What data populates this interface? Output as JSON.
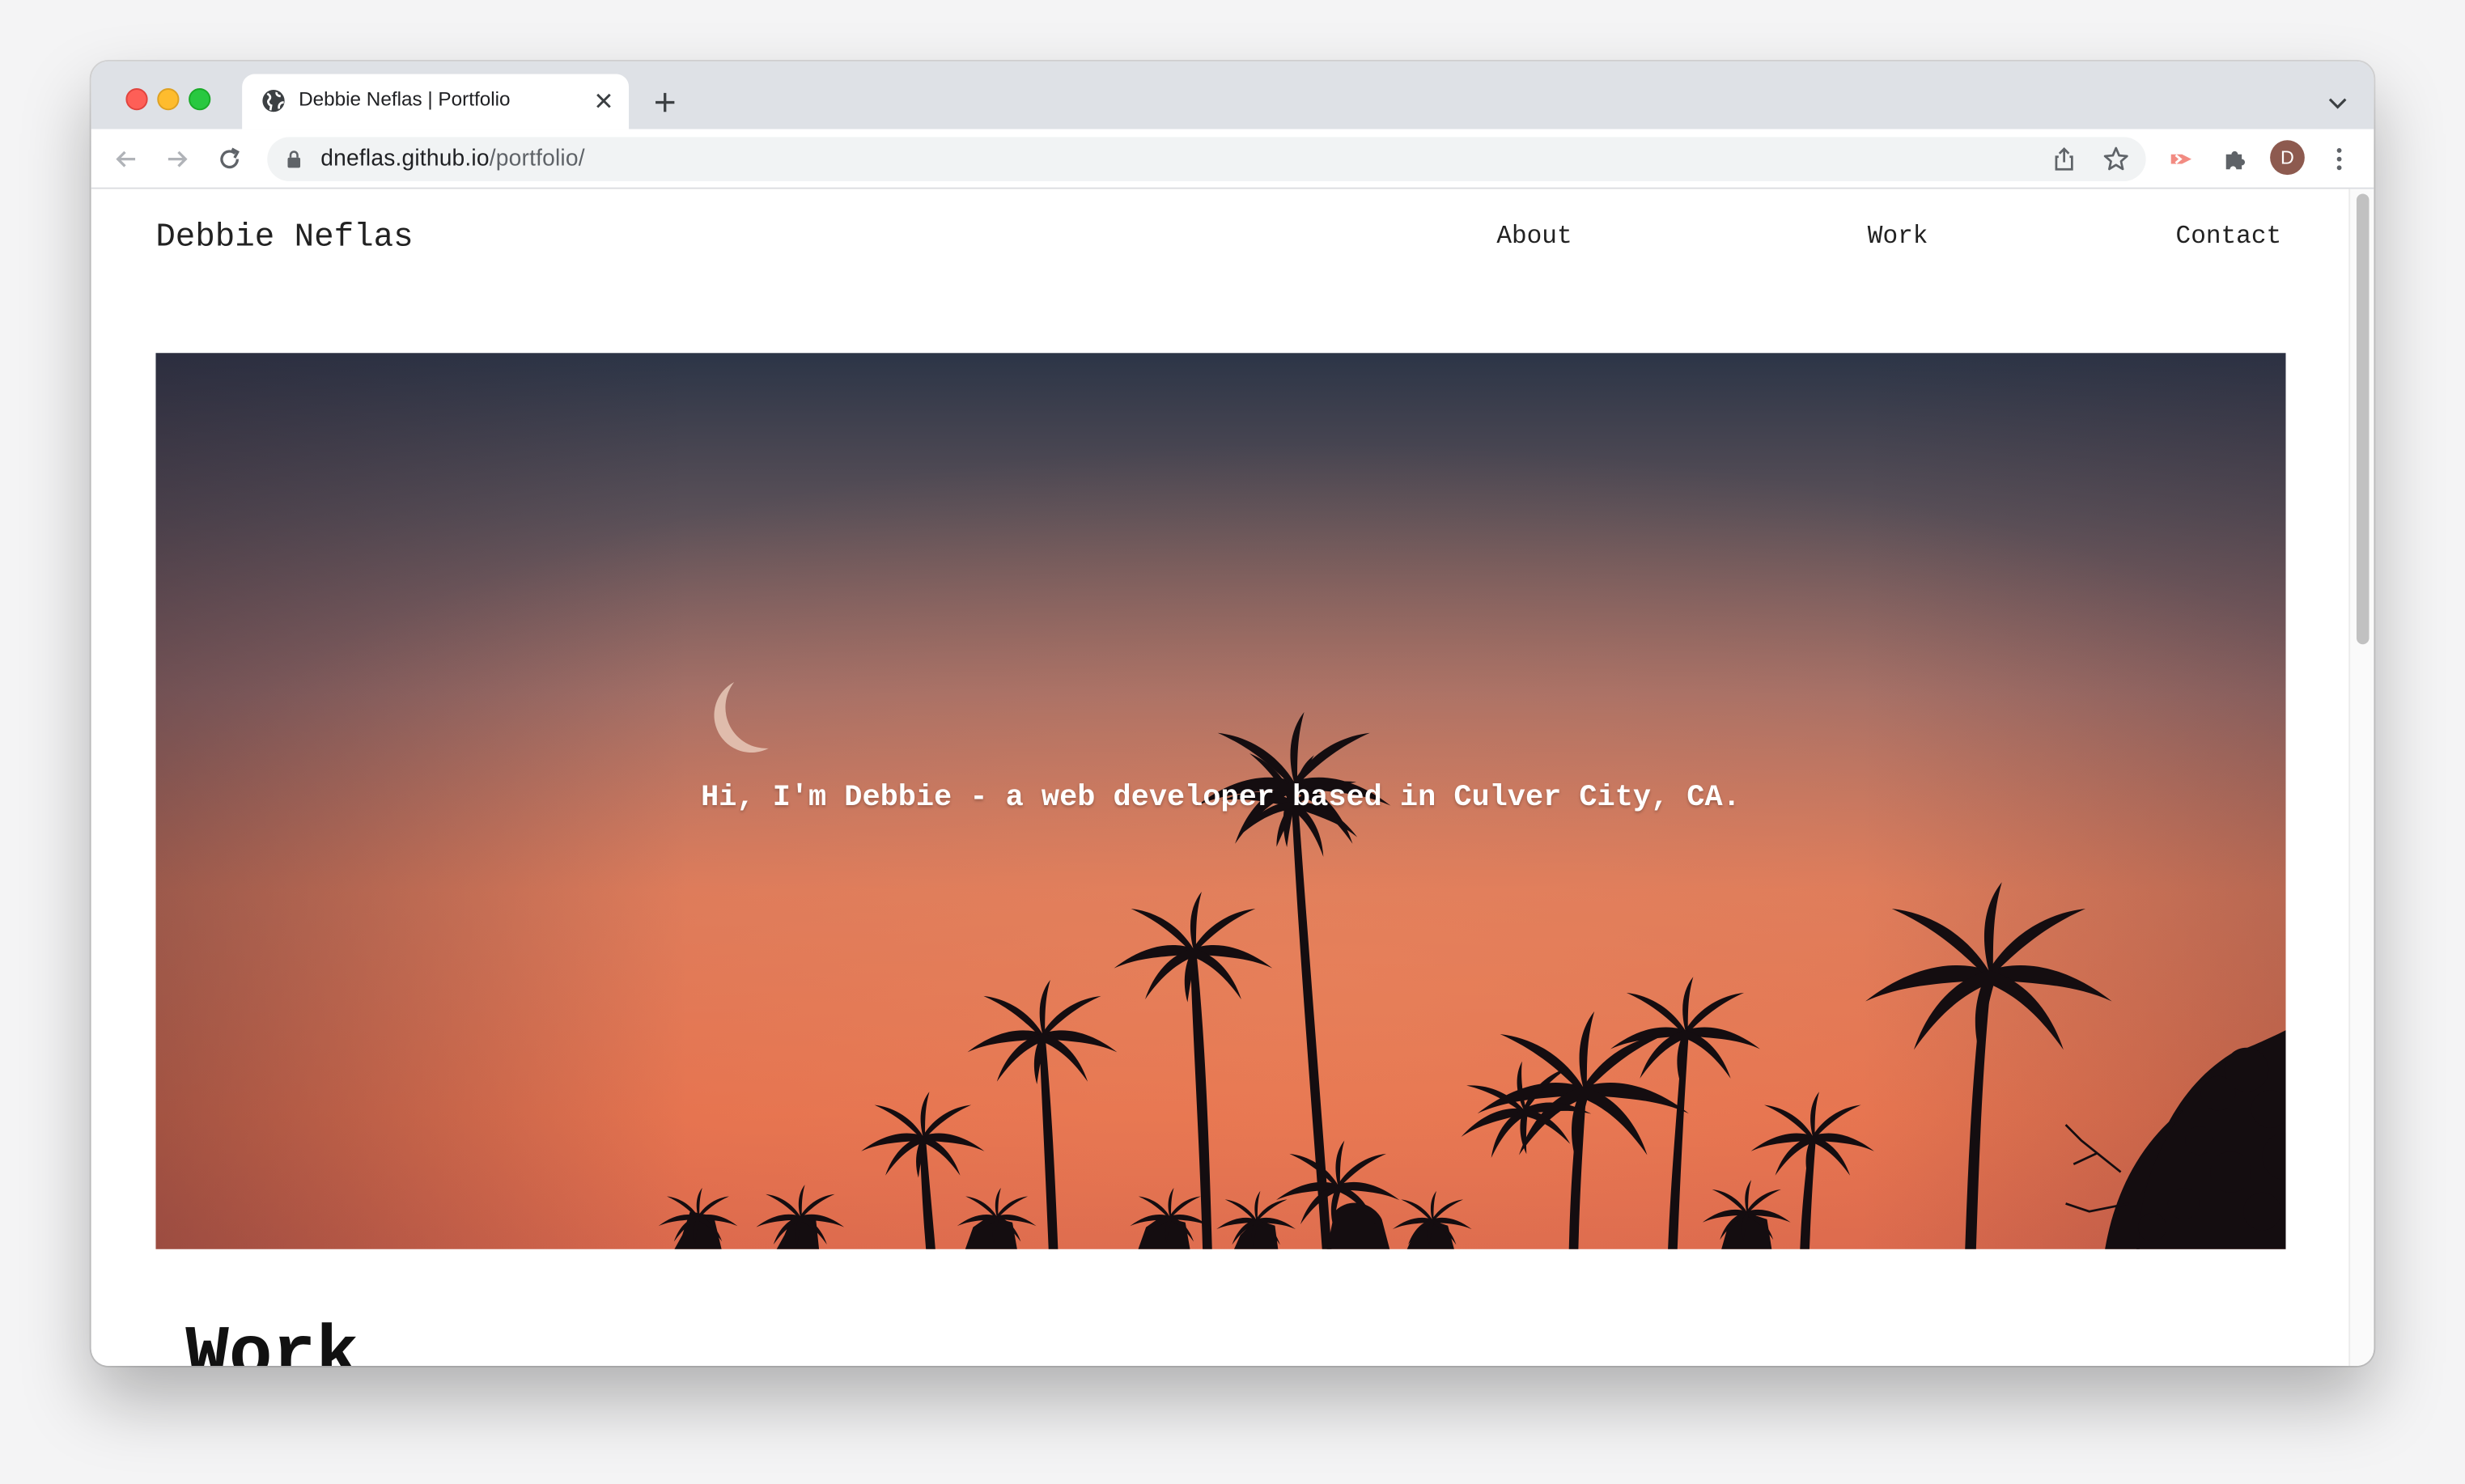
{
  "browser": {
    "tab_title": "Debbie Neflas | Portfolio",
    "url_host": "dneflas.github.io",
    "url_path": "/portfolio/",
    "profile_initial": "D",
    "icons": [
      "globe-icon",
      "close-icon",
      "plus-icon",
      "chevron-down-icon",
      "back-icon",
      "forward-icon",
      "reload-icon",
      "lock-icon",
      "share-icon",
      "star-icon",
      "extension-icon",
      "puzzle-icon",
      "more-icon"
    ]
  },
  "site": {
    "name": "Debbie Neflas",
    "nav": [
      {
        "label": "About"
      },
      {
        "label": "Work"
      },
      {
        "label": "Contact"
      }
    ],
    "hero_text": "Hi, I'm Debbie - a web developer based in Culver City, CA.",
    "section_heading": "Work"
  },
  "colors": {
    "sky_top": "#2c3547",
    "sky_mid": "#a8736e",
    "sky_bottom": "#e3714c",
    "silhouette": "#140d10"
  }
}
